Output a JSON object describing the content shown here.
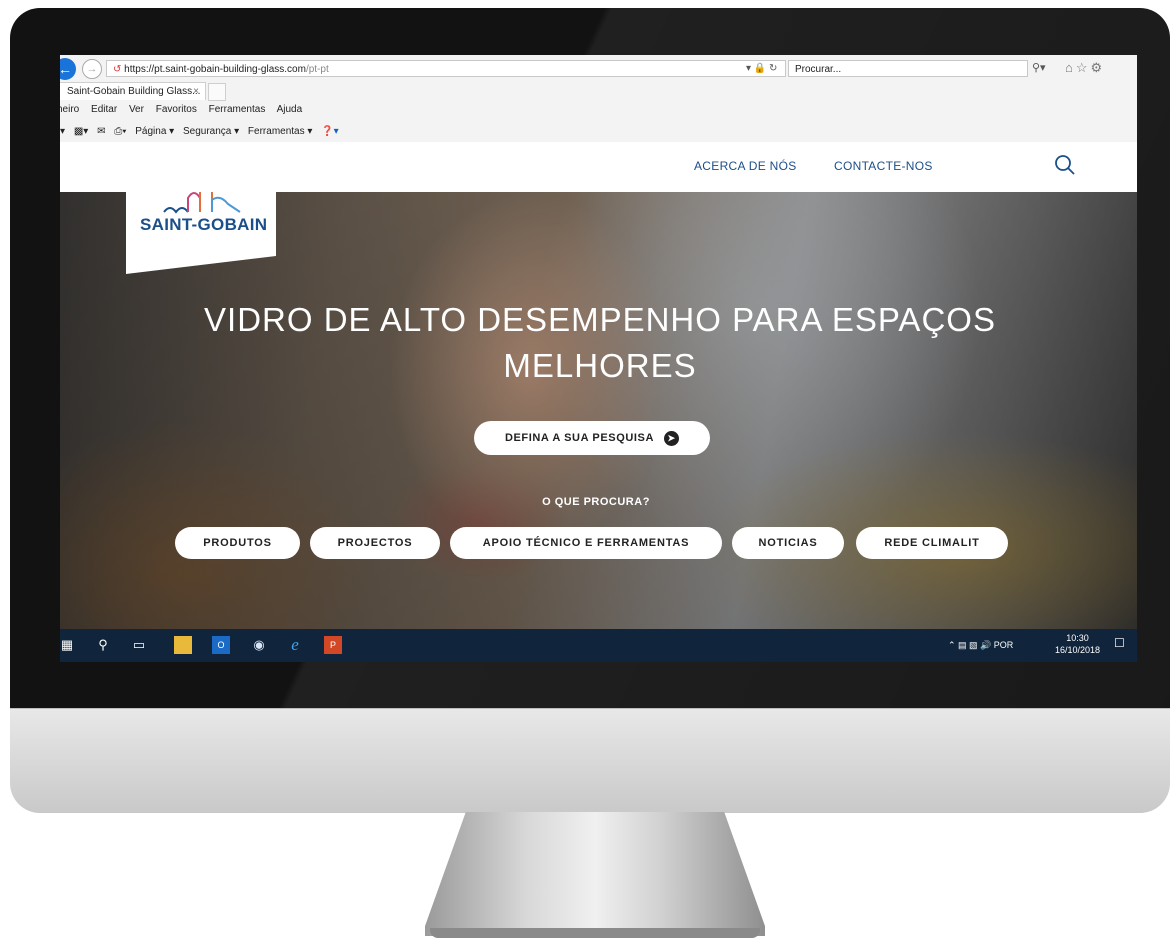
{
  "browser": {
    "url_main": "https://pt.saint-gobain-building-glass.com",
    "url_path": "/pt-pt",
    "search_placeholder": "Procurar...",
    "tab_title": "Saint-Gobain Building Glass...",
    "menu": [
      "cheiro",
      "Editar",
      "Ver",
      "Favoritos",
      "Ferramentas",
      "Ajuda"
    ],
    "commands": [
      "Página ▾",
      "Segurança ▾",
      "Ferramentas ▾"
    ]
  },
  "site": {
    "nav": {
      "about": "ACERCA DE NÓS",
      "contact": "CONTACTE-NOS"
    },
    "logo_text": "SAINT-GOBAIN",
    "hero_title": "VIDRO DE ALTO DESEMPENHO PARA ESPAÇOS MELHORES",
    "cta_label": "DEFINA A SUA PESQUISA",
    "question": "O QUE PROCURA?",
    "categories": [
      "PRODUTOS",
      "PROJECTOS",
      "APOIO TÉCNICO E FERRAMENTAS",
      "NOTICIAS",
      "REDE CLIMALIT"
    ]
  },
  "taskbar": {
    "language": "POR",
    "time": "10:30",
    "date": "16/10/2018"
  },
  "colors": {
    "brand_blue": "#1b4f8a",
    "taskbar": "#10243b"
  }
}
